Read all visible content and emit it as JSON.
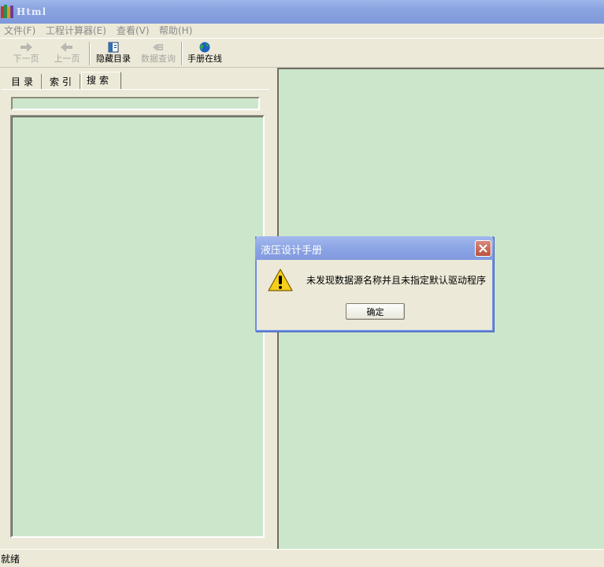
{
  "window": {
    "title": "Html"
  },
  "menu": {
    "file": "文件(F)",
    "calculator": "工程计算器(E)",
    "view": "查看(V)",
    "help": "帮助(H)"
  },
  "toolbar": {
    "next": "下一页",
    "prev": "上一页",
    "hide_toc": "隐藏目录",
    "data_query": "数据查询",
    "manual_online": "手册在线"
  },
  "tabs": {
    "toc": "目录",
    "index": "索引",
    "search": "搜索"
  },
  "search": {
    "value": ""
  },
  "status": {
    "text": "就绪"
  },
  "dialog": {
    "title": "液压设计手册",
    "message": "未发现数据源名称并且未指定默认驱动程序",
    "ok": "确定",
    "icon": "warning-icon"
  },
  "colors": {
    "content_bg": "#cce6cc",
    "window_bg": "#ece9d8",
    "titlebar": "#8aa3e0"
  }
}
